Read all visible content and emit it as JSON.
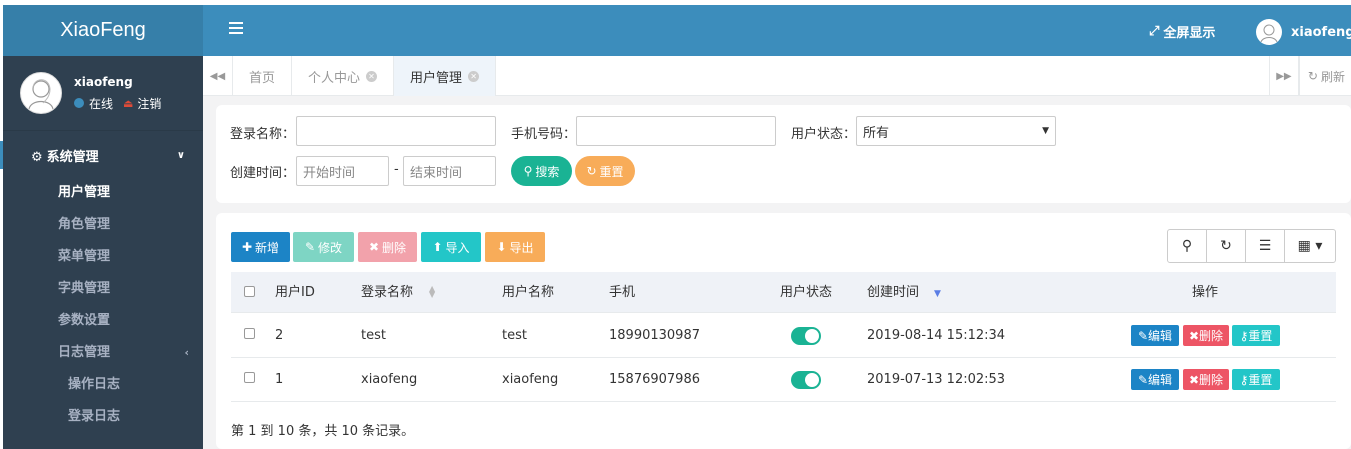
{
  "app": {
    "logo": "XiaoFeng"
  },
  "user_panel": {
    "name": "xiaofeng",
    "status": "在线",
    "logout": "注销"
  },
  "menu": {
    "group": "系统管理",
    "items": [
      {
        "label": "用户管理",
        "active": true
      },
      {
        "label": "角色管理"
      },
      {
        "label": "菜单管理"
      },
      {
        "label": "字典管理"
      },
      {
        "label": "参数设置"
      },
      {
        "label": "日志管理",
        "has_children": true
      }
    ],
    "log_children": [
      {
        "label": "操作日志"
      },
      {
        "label": "登录日志"
      }
    ]
  },
  "header": {
    "fullscreen": "全屏显示",
    "user": "xiaofeng"
  },
  "tabs": {
    "items": [
      {
        "label": "首页"
      },
      {
        "label": "个人中心"
      },
      {
        "label": "用户管理"
      }
    ],
    "refresh": "刷新"
  },
  "search": {
    "login_name_label": "登录名称：",
    "login_name_value": "",
    "phone_label": "手机号码：",
    "phone_value": "",
    "status_label": "用户状态：",
    "status_selected": "所有",
    "created_label": "创建时间：",
    "start_placeholder": "开始时间",
    "separator": "-",
    "end_placeholder": "结束时间",
    "search_btn": "搜索",
    "reset_btn": "重置"
  },
  "toolbar": {
    "add": "新增",
    "edit": "修改",
    "delete": "删除",
    "import": "导入",
    "export": "导出"
  },
  "colors": {
    "header": "#3c8dbc",
    "sidebar": "#2f4050",
    "primary": "#1c84c6",
    "success": "#1ab394",
    "danger": "#ed5565",
    "info": "#23c6c8",
    "warning": "#f8ac59"
  },
  "table": {
    "headers": {
      "id": "用户ID",
      "login_name": "登录名称",
      "user_name": "用户名称",
      "phone": "手机",
      "status": "用户状态",
      "created": "创建时间",
      "ops": "操作"
    },
    "rows": [
      {
        "id": "2",
        "login_name": "test",
        "user_name": "test",
        "phone": "18990130987",
        "status_on": true,
        "created": "2019-08-14 15:12:34"
      },
      {
        "id": "1",
        "login_name": "xiaofeng",
        "user_name": "xiaofeng",
        "phone": "15876907986",
        "status_on": true,
        "created": "2019-07-13 12:02:53"
      }
    ],
    "op_labels": {
      "edit": "编辑",
      "delete": "删除",
      "reset": "重置"
    }
  },
  "pagination": {
    "summary": "第 1 到 10 条，共 10 条记录。"
  }
}
